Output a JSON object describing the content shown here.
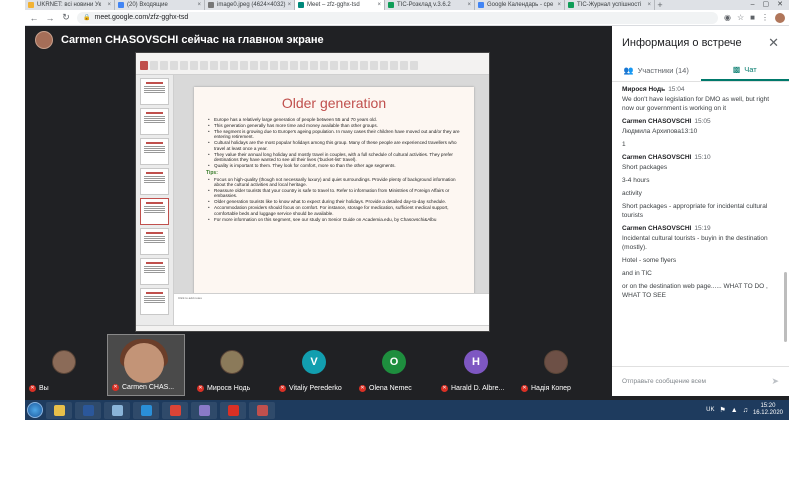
{
  "browser": {
    "tabs": [
      {
        "title": "UKRNET: всі новини Ук",
        "color": "#f2b233",
        "active": false
      },
      {
        "title": "(20) Входящие",
        "color": "#4285f4",
        "active": false
      },
      {
        "title": "image0.jpeg (4624×4032)",
        "color": "#777777",
        "active": false
      },
      {
        "title": "Meet – zfz-gghx-tsd",
        "color": "#00897b",
        "active": true
      },
      {
        "title": "TIC-Розклад v.3.6.2",
        "color": "#0f9d58",
        "active": false
      },
      {
        "title": "Google Календарь - сре",
        "color": "#4285f4",
        "active": false
      },
      {
        "title": "TIC-Журнал успішності",
        "color": "#0f9d58",
        "active": false
      }
    ],
    "url": "meet.google.com/zfz-gghx-tsd"
  },
  "meet": {
    "presenter_banner": "Carmen CHASOVSCHI сейчас на главном экране",
    "slide": {
      "title": "Older generation",
      "bullets": [
        "Europe has a relatively large generation of people between 55 and 70 years old.",
        "This generation generally has more time and money available than other groups.",
        "The segment is growing due to Europe's ageing population. In many cases their children have moved out and/or they are entering retirement.",
        "Cultural holidays are the most popular holidays among this group. Many of these people are experienced travellers who travel at least once a year.",
        "They value their annual long holiday and mostly travel in couples, with a full schedule of cultural activities. They prefer destinations they have wanted to see all their lives ('bucket-list' travel).",
        "Quality is important to them. They look for comfort, more so than the other age segments."
      ],
      "tips_label": "Tips:",
      "tips": [
        "Focus on high-quality (though not necessarily luxury) and quiet surroundings. Provide plenty of background information about the cultural activities and local heritage.",
        "Reassure older tourists that your country is safe to travel to. Refer to information from Ministries of Foreign Affairs or embassies.",
        "Older generation tourists like to know what to expect during their holidays. Provide a detailed day-to-day schedule.",
        "Accommodation providers should focus on comfort. For instance, storage for medication, sufficient medical support, comfortable beds and luggage service should be available.",
        "For more information on this segment, see our study on Senior Guide on Academia.edu, by Chasovschi&Albu"
      ],
      "notes_placeholder": "Click to add notes"
    },
    "participants": [
      {
        "name": "Вы",
        "initial": "",
        "color": "#8b6b58",
        "photo": true
      },
      {
        "name": "Carmen CHAS...",
        "initial": "",
        "color": "#4a4a4a",
        "video": true
      },
      {
        "name": "Миросв Нодь",
        "initial": "",
        "color": "#8b7a5a",
        "photo": true
      },
      {
        "name": "Vitaliy Perederko",
        "initial": "V",
        "color": "#129eaf"
      },
      {
        "name": "Olena Nemec",
        "initial": "O",
        "color": "#1e8e3e"
      },
      {
        "name": "Harald D. Albre...",
        "initial": "H",
        "color": "#7e57c2"
      },
      {
        "name": "Надія Копер",
        "initial": "",
        "color": "#6d5046",
        "photo": true
      }
    ]
  },
  "panel": {
    "title": "Информация о встрече",
    "tab_participants": "Участники (14)",
    "tab_chat": "Чат",
    "messages": [
      {
        "sender": "Мирося Нодь",
        "time": "15:04",
        "lines": [
          "We don't have legislation for DMO as well, but right now our government is working on it"
        ]
      },
      {
        "sender": "Carmen CHASOVSCHI",
        "time": "15:05",
        "lines": [
          "Людмила Архипова13:10",
          "1"
        ]
      },
      {
        "sender": "Carmen CHASOVSCHI",
        "time": "15:10",
        "lines": [
          "Short packages",
          "3-4 hours",
          "activity",
          "Short packages - appropriate for incidental cultural tourists"
        ]
      },
      {
        "sender": "Carmen CHASOVSCHI",
        "time": "15:19",
        "lines": [
          "Incidental cultural tourists - buyin in the destination (mostly).",
          "Hotel - some flyers",
          "and in TIC",
          "or on the destination web page...... WHAT TO DO , WHAT TO SEE"
        ]
      }
    ],
    "input_placeholder": "Отправьте сообщение всем"
  },
  "taskbar": {
    "apps": [
      {
        "name": "explorer",
        "color": "#e8c04a"
      },
      {
        "name": "word",
        "color": "#2b579a"
      },
      {
        "name": "notepad",
        "color": "#8ab4d8"
      },
      {
        "name": "edge",
        "color": "#2a8fd8"
      },
      {
        "name": "chrome",
        "color": "#db4437"
      },
      {
        "name": "other",
        "color": "#8a7ac8"
      },
      {
        "name": "acrobat",
        "color": "#d93025"
      },
      {
        "name": "powerpoint",
        "color": "#c0504d"
      }
    ],
    "language": "UK",
    "time": "15:20",
    "date": "16.12.2020"
  }
}
